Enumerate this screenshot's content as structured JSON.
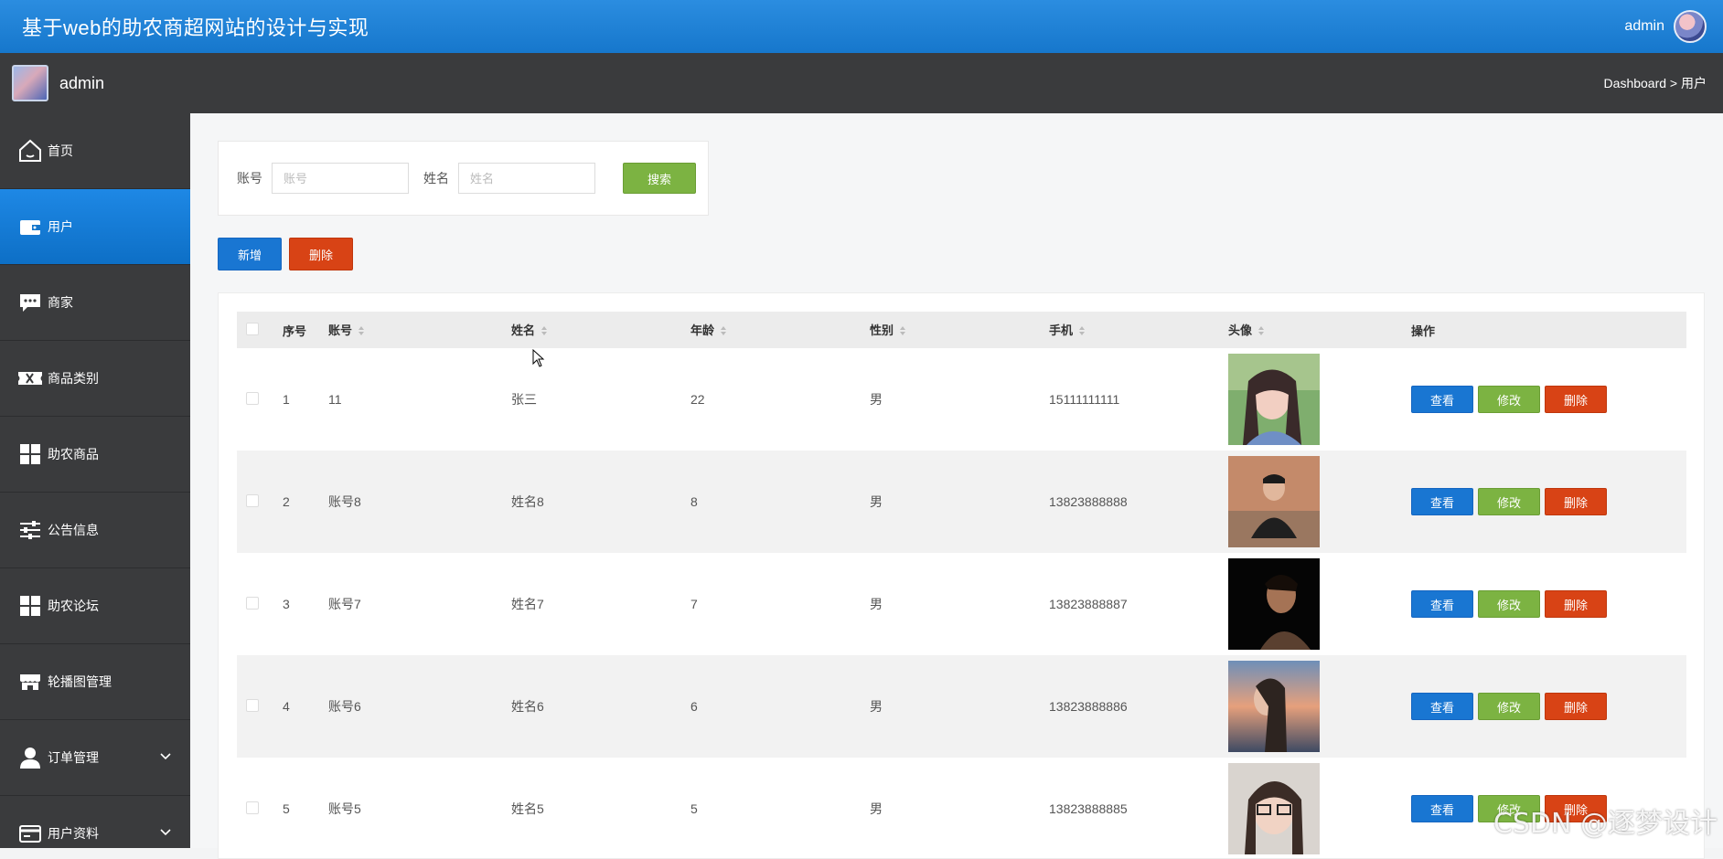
{
  "header": {
    "title": "基于web的助农商超网站的设计与实现",
    "username": "admin"
  },
  "subbar": {
    "username": "admin",
    "breadcrumb": "Dashboard > 用户"
  },
  "sidebar": {
    "items": [
      {
        "label": "首页",
        "icon": "home-icon"
      },
      {
        "label": "用户",
        "icon": "wallet-icon",
        "active": true
      },
      {
        "label": "商家",
        "icon": "chat-icon"
      },
      {
        "label": "商品类别",
        "icon": "ticket-icon"
      },
      {
        "label": "助农商品",
        "icon": "grid-icon"
      },
      {
        "label": "公告信息",
        "icon": "sliders-icon"
      },
      {
        "label": "助农论坛",
        "icon": "grid-icon"
      },
      {
        "label": "轮播图管理",
        "icon": "store-icon"
      },
      {
        "label": "订单管理",
        "icon": "user-icon",
        "expandable": true
      },
      {
        "label": "用户资料",
        "icon": "card-icon",
        "expandable": true
      }
    ]
  },
  "search": {
    "account_label": "账号",
    "account_placeholder": "账号",
    "name_label": "姓名",
    "name_placeholder": "姓名",
    "button": "搜索"
  },
  "actions": {
    "add": "新增",
    "delete": "删除"
  },
  "table": {
    "columns": [
      "序号",
      "账号",
      "姓名",
      "年龄",
      "性别",
      "手机",
      "头像",
      "操作"
    ],
    "rows": [
      {
        "index": "1",
        "account": "11",
        "name": "张三",
        "age": "22",
        "gender": "男",
        "phone": "15111111111"
      },
      {
        "index": "2",
        "account": "账号8",
        "name": "姓名8",
        "age": "8",
        "gender": "男",
        "phone": "13823888888"
      },
      {
        "index": "3",
        "account": "账号7",
        "name": "姓名7",
        "age": "7",
        "gender": "男",
        "phone": "13823888887"
      },
      {
        "index": "4",
        "account": "账号6",
        "name": "姓名6",
        "age": "6",
        "gender": "男",
        "phone": "13823888886"
      },
      {
        "index": "5",
        "account": "账号5",
        "name": "姓名5",
        "age": "5",
        "gender": "男",
        "phone": "13823888885"
      }
    ],
    "row_actions": {
      "view": "查看",
      "edit": "修改",
      "delete": "删除"
    }
  },
  "watermark": "CSDN @逐梦设计",
  "colors": {
    "primary": "#1976d2",
    "success": "#7cb342",
    "danger": "#d84315",
    "sidebar_bg": "#3a3b3d"
  }
}
